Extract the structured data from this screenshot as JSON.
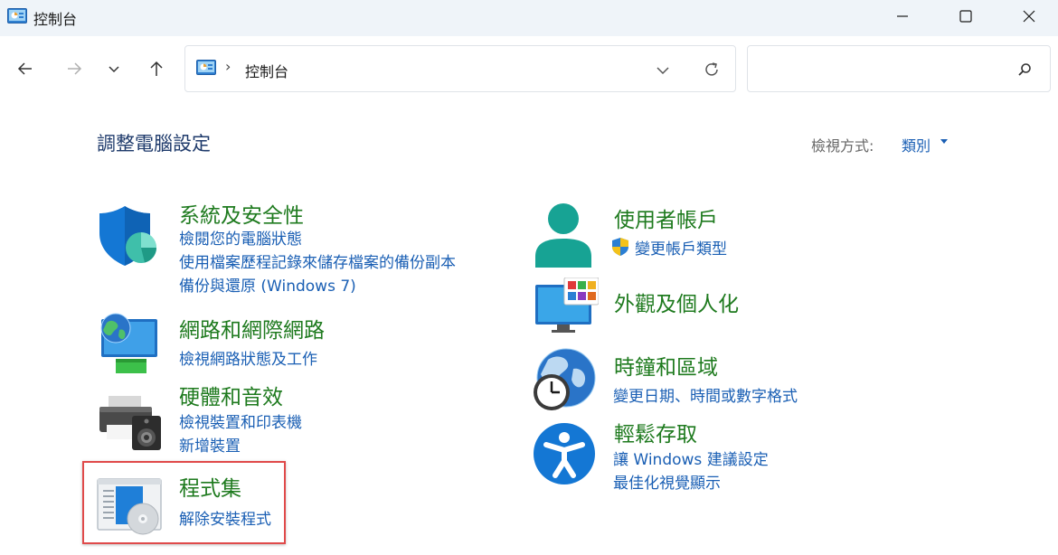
{
  "window": {
    "title": "控制台"
  },
  "address": {
    "separator": "›",
    "path": "控制台"
  },
  "search": {
    "placeholder": ""
  },
  "main": {
    "heading": "調整電腦設定",
    "view_by_label": "檢視方式:",
    "view_by_value": "類別"
  },
  "left_categories": [
    {
      "title": "系統及安全性",
      "links": [
        "檢閱您的電腦狀態",
        "使用檔案歷程記錄來儲存檔案的備份副本",
        "備份與還原 (Windows 7)"
      ]
    },
    {
      "title": "網路和網際網路",
      "links": [
        "檢視網路狀態及工作"
      ]
    },
    {
      "title": "硬體和音效",
      "links": [
        "檢視裝置和印表機",
        "新增裝置"
      ]
    },
    {
      "title": "程式集",
      "links": [
        "解除安裝程式"
      ]
    }
  ],
  "right_categories": [
    {
      "title": "使用者帳戶",
      "links": [
        "變更帳戶類型"
      ]
    },
    {
      "title": "外觀及個人化",
      "links": []
    },
    {
      "title": "時鐘和區域",
      "links": [
        "變更日期、時間或數字格式"
      ]
    },
    {
      "title": "輕鬆存取",
      "links": [
        "讓 Windows 建議設定",
        "最佳化視覺顯示"
      ]
    }
  ],
  "icons": {
    "app": "control-panel-icon",
    "back": "arrow-left-icon",
    "forward": "arrow-right-icon",
    "recent": "chevron-down-icon",
    "up": "arrow-up-icon",
    "refresh": "refresh-icon",
    "search": "search-icon",
    "shield": "uac-shield-icon"
  },
  "colors": {
    "category_title": "#1e7a1e",
    "link": "#1a5fb4",
    "heading": "#1e3a6b",
    "highlight_border": "#e04a4a",
    "titlebar_bg": "#eff4f9"
  }
}
